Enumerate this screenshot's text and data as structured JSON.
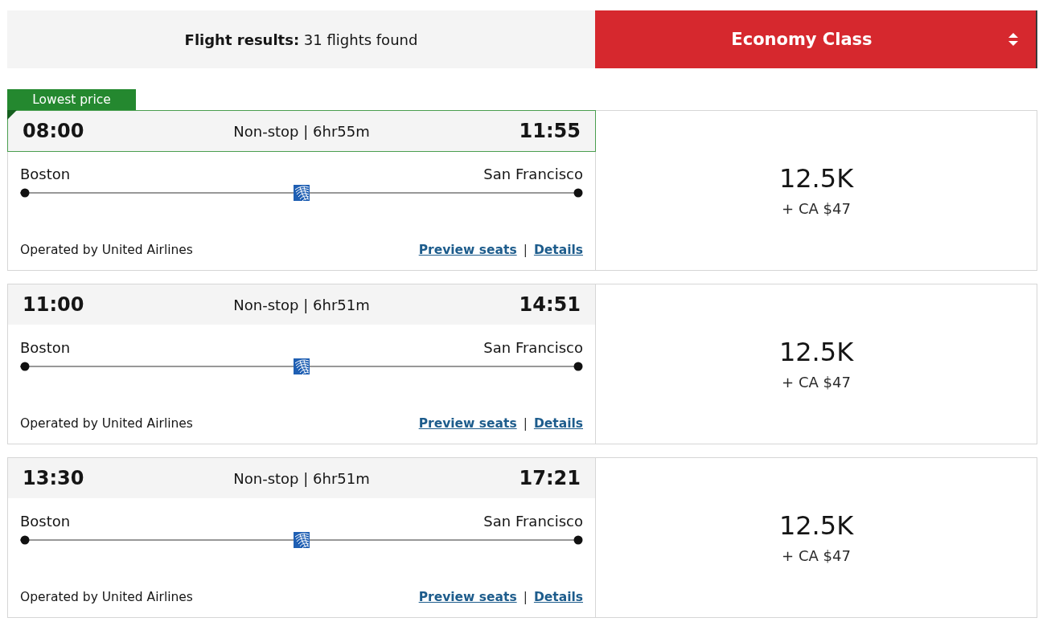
{
  "header": {
    "results_summary": "**Flight results:** 31 flights found",
    "cabin_selector": {
      "label": "Economy Class"
    }
  },
  "flights": [
    {
      "badge": "Lowest price",
      "depart_time": "08:00",
      "summary": "Non-stop | 6hr55m",
      "arrive_time": "11:55",
      "origin": "Boston",
      "destination": "San Francisco",
      "operator": "Operated by United Airlines",
      "links": [
        "Preview seats",
        "Details"
      ],
      "link_separator": "|",
      "price_points": "12.5K",
      "price_cash": "+ CA $47"
    },
    {
      "depart_time": "11:00",
      "summary": "Non-stop | 6hr51m",
      "arrive_time": "14:51",
      "origin": "Boston",
      "destination": "San Francisco",
      "operator": "Operated by United Airlines",
      "links": [
        "Preview seats",
        "Details"
      ],
      "link_separator": "|",
      "price_points": "12.5K",
      "price_cash": "+ CA $47"
    },
    {
      "depart_time": "13:30",
      "summary": "Non-stop | 6hr51m",
      "arrive_time": "17:21",
      "origin": "Boston",
      "destination": "San Francisco",
      "operator": "Operated by United Airlines",
      "links": [
        "Preview seats",
        "Details"
      ],
      "link_separator": "|",
      "price_points": "12.5K",
      "price_cash": "+ CA $47"
    }
  ]
}
